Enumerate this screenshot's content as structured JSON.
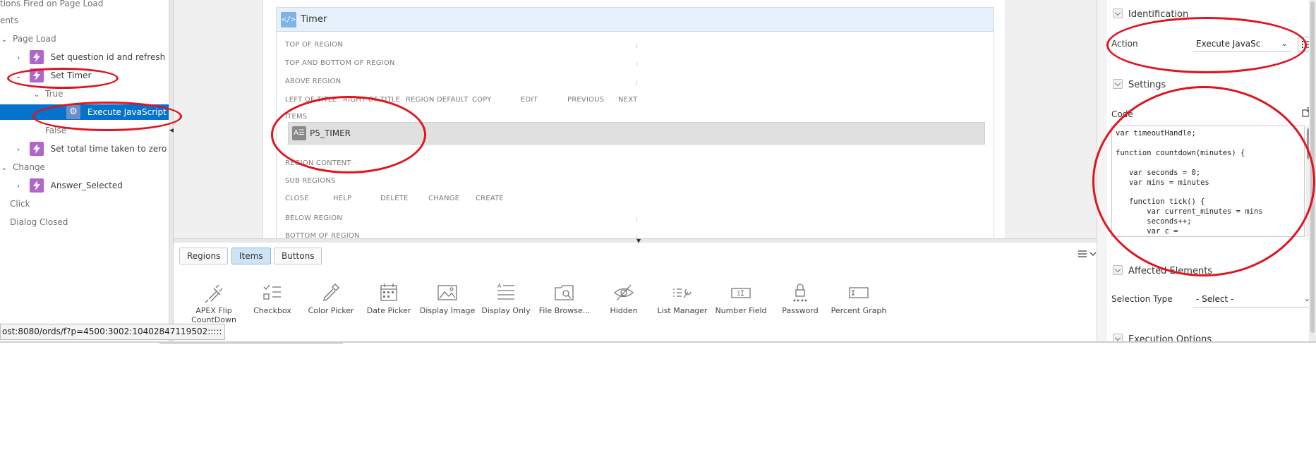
{
  "tree": {
    "nodes": [
      {
        "label": "tions Fired on Page Load",
        "kind": "plain"
      },
      {
        "label": "ents",
        "kind": "plain"
      },
      {
        "label": "Page Load",
        "kind": "group"
      },
      {
        "label": "Set question id and refresh",
        "kind": "da"
      },
      {
        "label": "Set Timer",
        "kind": "da"
      },
      {
        "label": "True",
        "kind": "muted"
      },
      {
        "label": "Execute JavaScript Code",
        "kind": "action"
      },
      {
        "label": "False",
        "kind": "muted"
      },
      {
        "label": "Set total time taken to zero",
        "kind": "da"
      },
      {
        "label": "Change",
        "kind": "group"
      },
      {
        "label": "Answer_Selected",
        "kind": "da"
      },
      {
        "label": "Click",
        "kind": "muted"
      },
      {
        "label": "Dialog Closed",
        "kind": "muted"
      }
    ]
  },
  "layout": {
    "region_title": "Timer",
    "region_icon": "</>",
    "positions": {
      "top_of_region": "TOP OF REGION",
      "top_and_bottom": "TOP AND BOTTOM OF REGION",
      "above_region": "ABOVE REGION",
      "left_of_title": "LEFT OF TITLE",
      "right_of_title": "RIGHT OF TITLE",
      "region_default": "REGION DEFAULT",
      "copy": "COPY",
      "edit": "EDIT",
      "previous": "PREVIOUS",
      "next": "NEXT",
      "items": "ITEMS",
      "region_content": "REGION CONTENT",
      "sub_regions": "SUB REGIONS",
      "close": "CLOSE",
      "help": "HELP",
      "delete": "DELETE",
      "change": "CHANGE",
      "create": "CREATE",
      "below_region": "BELOW REGION",
      "bottom_of_region": "BOTTOM OF REGION"
    },
    "item_label": "P5_TIMER"
  },
  "gallery": {
    "tabs": [
      "Regions",
      "Items",
      "Buttons"
    ],
    "active_tab": "Items",
    "items": [
      {
        "label": "APEX Flip CountDown",
        "icon": "plug-icon"
      },
      {
        "label": "Checkbox",
        "icon": "checkbox-icon"
      },
      {
        "label": "Color Picker",
        "icon": "eyedropper-icon"
      },
      {
        "label": "Date Picker",
        "icon": "calendar-icon"
      },
      {
        "label": "Display Image",
        "icon": "image-icon"
      },
      {
        "label": "Display Only",
        "icon": "text-lines-icon"
      },
      {
        "label": "File Browse...",
        "icon": "folder-search-icon"
      },
      {
        "label": "Hidden",
        "icon": "eye-slash-icon"
      },
      {
        "label": "List Manager",
        "icon": "list-wrench-icon"
      },
      {
        "label": "Number Field",
        "icon": "number-field-icon"
      },
      {
        "label": "Password",
        "icon": "lock-icon"
      },
      {
        "label": "Percent Graph",
        "icon": "percent-graph-icon"
      }
    ]
  },
  "props": {
    "identification": {
      "title": "Identification",
      "action_label": "Action",
      "action_value": "Execute JavaSc"
    },
    "settings": {
      "title": "Settings",
      "code_label": "Code",
      "code": "var timeoutHandle;\n\nfunction countdown(minutes) {\n\n   var seconds = 0;\n   var mins = minutes\n\n   function tick() {\n       var current_minutes = mins\n       seconds++;\n       var c ="
    },
    "affected": {
      "title": "Affected Elements",
      "selection_type_label": "Selection Type",
      "selection_type_value": "- Select -"
    },
    "execution": {
      "title": "Execution Options"
    }
  },
  "status_url": "ost:8080/ords/f?p=4500:3002:10402847119502:::::",
  "colors": {
    "accent": "#0572ce",
    "annotation": "#e0141e",
    "dynamic_action": "#b266cc"
  }
}
